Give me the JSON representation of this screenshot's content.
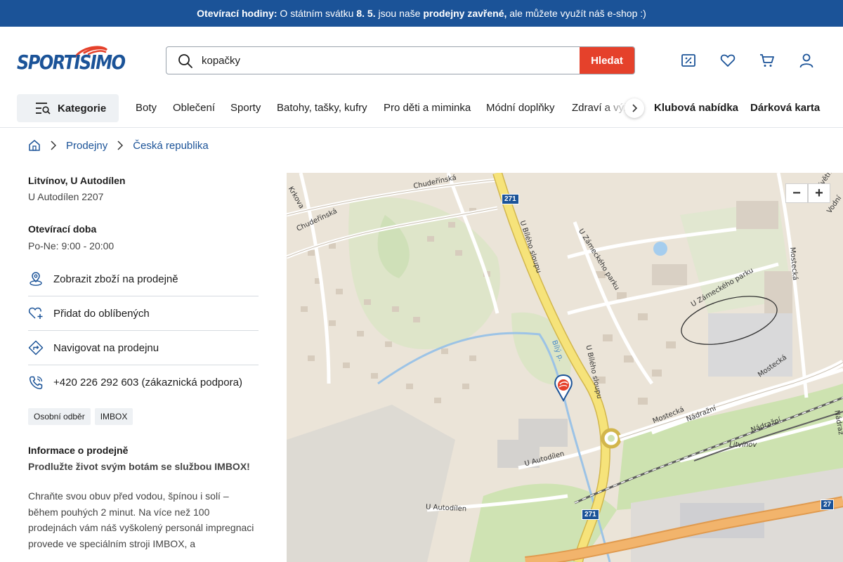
{
  "announcement": {
    "bold_label": "Otevírací hodiny:",
    "text_1": "O státním svátku",
    "date": "8. 5.",
    "text_2": "jsou naše",
    "bold_closed": "prodejny zavřené,",
    "text_3": "ale můžete využít náš e-shop :)",
    "bg_color": "#1b5398"
  },
  "header": {
    "logo_text": "SPORTISIMO",
    "search": {
      "value": "kopačky",
      "button_label": "Hledat",
      "button_color": "#e5412b"
    },
    "icons": [
      "discount-icon",
      "heart-icon",
      "cart-icon",
      "user-icon"
    ]
  },
  "nav": {
    "categories_label": "Kategorie",
    "items": [
      "Boty",
      "Oblečení",
      "Sporty",
      "Batohy, tašky, kufry",
      "Pro děti a miminka",
      "Módní doplňky",
      "Zdraví a výživa"
    ],
    "highlight_items": [
      "Klubová nabídka",
      "Dárková karta"
    ]
  },
  "breadcrumb": {
    "items": [
      "Prodejny",
      "Česká republika"
    ]
  },
  "store": {
    "name": "Litvínov, U Autodílen",
    "address": "U Autodílen 2207",
    "hours_title": "Otevírací doba",
    "hours": "Po-Ne: 9:00 - 20:00",
    "actions": [
      {
        "label": "Zobrazit zboží na prodejně",
        "icon": "store-pin-icon"
      },
      {
        "label": "Přidat do oblíbených",
        "icon": "heart-plus-icon"
      },
      {
        "label": "Navigovat na prodejnu",
        "icon": "directions-icon"
      },
      {
        "label": "+420 226 292 603 (zákaznická podpora)",
        "icon": "phone-icon"
      }
    ],
    "tags": [
      "Osobní odběr",
      "IMBOX"
    ],
    "info_title": "Informace o prodejně",
    "info_subtitle": "Prodlužte život svým botám se službou IMBOX!",
    "info_text": "Chraňte svou obuv před vodou, špínou i solí – během pouhých 2 minut. Na více než 100 prodejnách vám náš vyškolený personál impregnaci provede ve speciálním stroji IMBOX, a"
  },
  "map": {
    "zoom_out": "−",
    "zoom_in": "+",
    "labels": {
      "chuderinska_1": "Chudeřínská",
      "chuderinska_2": "Chudeřínská",
      "krkova": "Krkova",
      "bileho_sloupu_1": "U Bílého sloupu",
      "bileho_sloupu_2": "U Bílého sloupu",
      "zameckeho_parku_1": "U Zámeckého parku",
      "zameckeho_parku_2": "U Zámeckého parku",
      "mostecka_1": "Mostecká",
      "mostecka_2": "Mostecká",
      "mostecka_3": "Mostecká",
      "nadrazni_1": "Nádražní",
      "nadrazni_2": "Nádražní",
      "nadrazni_3": "Nádraž",
      "litvinov": "Litvínov",
      "autodilen_1": "U Autodílen",
      "autodilen_2": "U Autodílen",
      "bily_potok": "Bílý p.",
      "kvetn": "Květn",
      "vodni": "Vodní",
      "road_271_a": "271",
      "road_271_b": "271",
      "road_27": "27"
    }
  }
}
